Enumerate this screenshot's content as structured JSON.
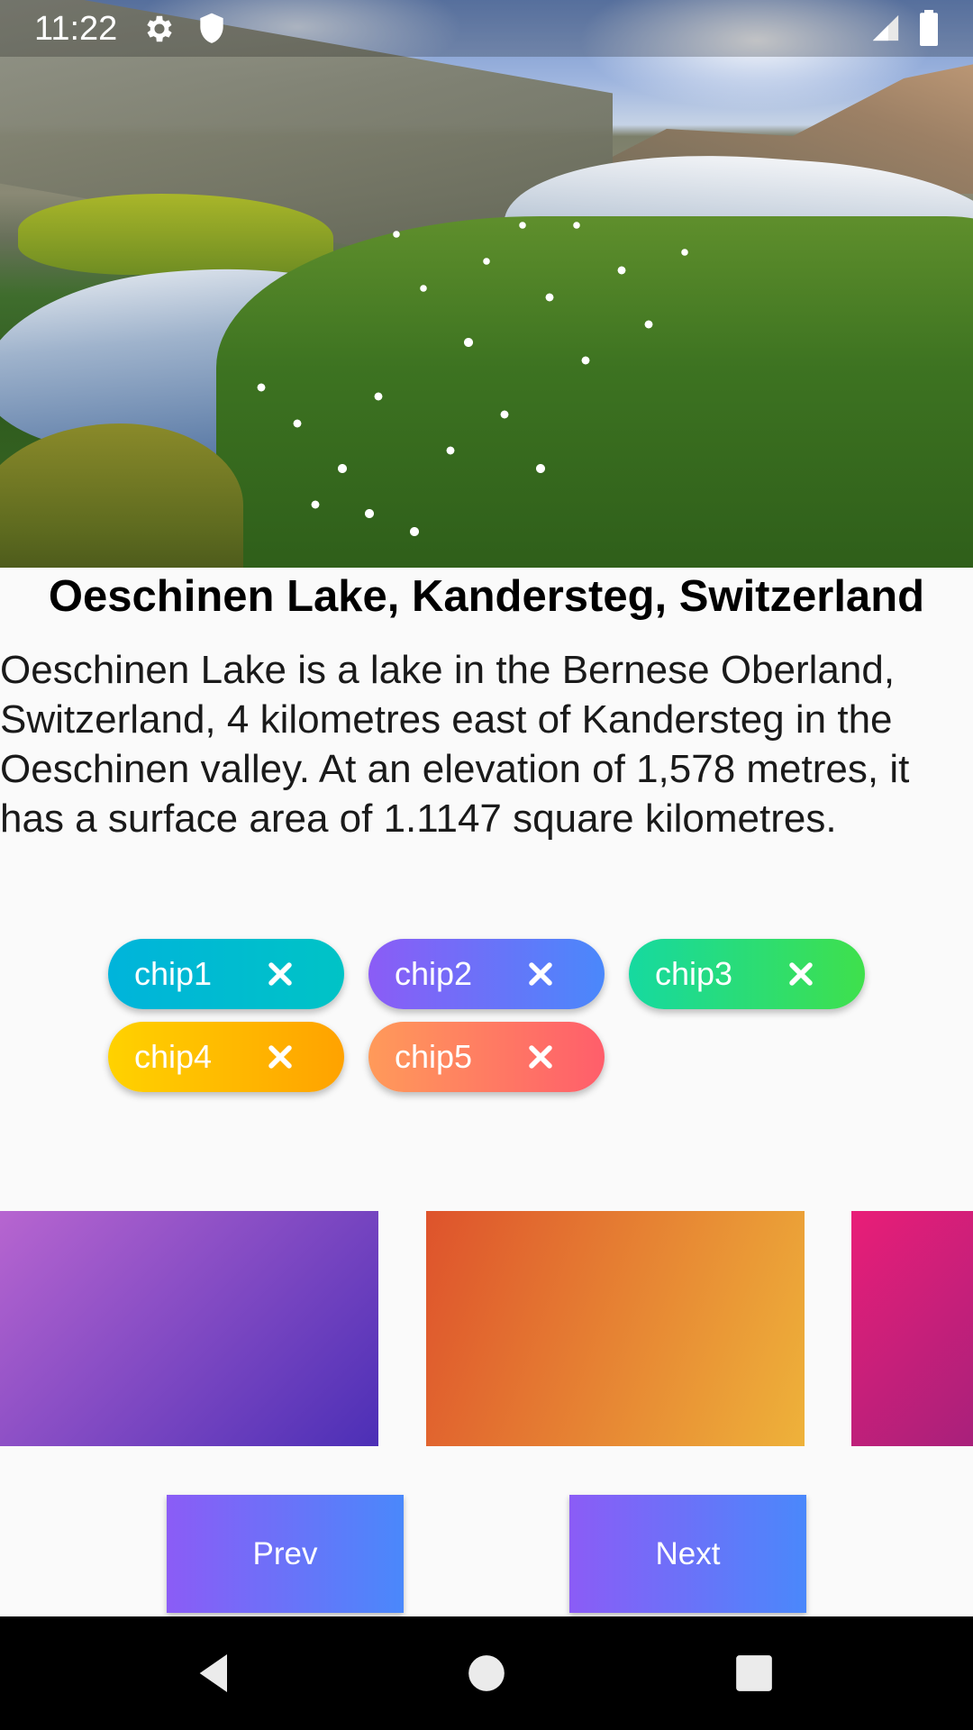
{
  "status_bar": {
    "time": "11:22",
    "icons": [
      "settings-icon",
      "shield-icon",
      "signal-icon",
      "battery-icon"
    ]
  },
  "hero": {
    "description": "photo-landscape"
  },
  "content": {
    "title": "Oeschinen Lake, Kandersteg, Switzerland",
    "description": "Oeschinen Lake is a lake in the Bernese Oberland, Switzerland, 4 kilometres east of Kandersteg in the Oeschinen valley. At an elevation of 1,578 metres, it has a surface area of 1.1147 square kilometres."
  },
  "chips": [
    {
      "label": "chip1",
      "colors": [
        "#00b4db",
        "#00c3c6"
      ]
    },
    {
      "label": "chip2",
      "colors": [
        "#8b5cf6",
        "#4a88fb"
      ]
    },
    {
      "label": "chip3",
      "colors": [
        "#16d9a0",
        "#3fe04c"
      ]
    },
    {
      "label": "chip4",
      "colors": [
        "#ffd200",
        "#ffa200"
      ]
    },
    {
      "label": "chip5",
      "colors": [
        "#ff9a5a",
        "#ff5e6b"
      ]
    }
  ],
  "cards": [
    {
      "colors": [
        "#b765d0",
        "#4c2fb6"
      ]
    },
    {
      "colors": [
        "#de532c",
        "#eeb23a"
      ]
    },
    {
      "colors": [
        "#e91e78",
        "#a8207b"
      ]
    }
  ],
  "buttons": {
    "prev_label": "Prev",
    "next_label": "Next"
  },
  "navbar": {
    "icons": [
      "back-icon",
      "home-icon",
      "recents-icon"
    ]
  }
}
